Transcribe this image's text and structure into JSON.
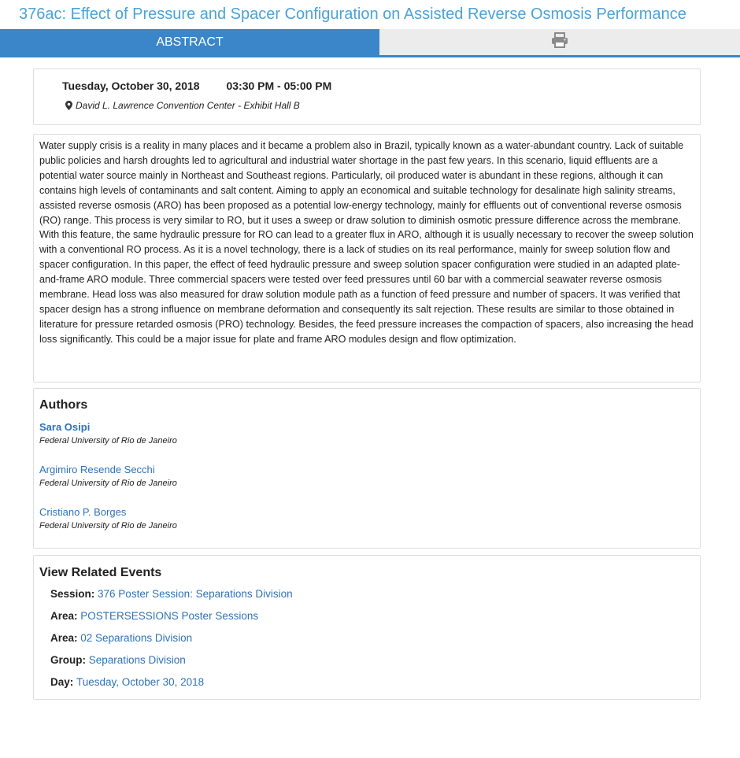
{
  "page": {
    "title": "376ac: Effect of Pressure and Spacer Configuration on Assisted Reverse Osmosis Performance"
  },
  "tabs": {
    "abstract_label": "ABSTRACT",
    "print_icon": "printer-icon"
  },
  "session_time": {
    "date": "Tuesday, October 30, 2018",
    "time": "03:30 PM - 05:00 PM",
    "location_icon": "map-marker-icon",
    "location": "David L. Lawrence Convention Center - Exhibit Hall B"
  },
  "abstract": {
    "text": "Water supply crisis is a reality in many places and it became a problem also in Brazil, typically known as a water-abundant country. Lack of suitable public policies and harsh droughts led to agricultural and industrial water shortage in the past few years. In this scenario, liquid effluents are a potential water source mainly in Northeast and Southeast regions. Particularly, oil produced water is abundant in these regions, although it can contains high levels of contaminants and salt content. Aiming to apply an economical and suitable technology for desalinate high salinity streams, assisted reverse osmosis (ARO) has been proposed as a potential low-energy technology, mainly for effluents out of conventional reverse osmosis (RO) range. This process is very similar to RO, but it uses a sweep or draw solution to diminish osmotic pressure difference across the membrane. With this feature, the same hydraulic pressure for RO can lead to a greater flux in ARO, although it is usually necessary to recover the sweep solution with a conventional RO process. As it is a novel technology, there is a lack of studies on its real performance, mainly for sweep solution flow and spacer configuration. In this paper, the effect of feed hydraulic pressure and sweep solution spacer configuration were studied in an adapted plate-and-frame ARO module. Three commercial spacers were tested over feed pressures until 60 bar with a commercial seawater reverse osmosis membrane. Head loss was also measured for draw solution module path as a function of feed pressure and number of spacers. It was verified that spacer design has a strong influence on membrane deformation and consequently its salt rejection. These results are similar to those obtained in literature for pressure retarded osmosis (PRO) technology. Besides, the feed pressure increases the compaction of spacers, also increasing the head loss significantly. This could be a major issue for plate and frame ARO modules design and flow optimization."
  },
  "authors": {
    "heading": "Authors",
    "list": [
      {
        "name": "Sara Osipi",
        "affiliation": "Federal University of Rio de Janeiro"
      },
      {
        "name": "Argimiro Resende Secchi",
        "affiliation": "Federal University of Rio de Janeiro"
      },
      {
        "name": "Cristiano P. Borges",
        "affiliation": "Federal University of Rio de Janeiro"
      }
    ]
  },
  "related": {
    "heading": "View Related Events",
    "rows": [
      {
        "key": "Session:",
        "value": "376 Poster Session: Separations Division"
      },
      {
        "key": "Area:",
        "value": "POSTERSESSIONS Poster Sessions"
      },
      {
        "key": "Area:",
        "value": "02 Separations Division"
      },
      {
        "key": "Group:",
        "value": "Separations Division"
      },
      {
        "key": "Day:",
        "value": "Tuesday, October 30, 2018"
      }
    ]
  },
  "colors": {
    "title": "#4aa3d9",
    "tab_active": "#3a86c8",
    "tab_inactive": "#ececec",
    "link": "#2e72b8"
  }
}
